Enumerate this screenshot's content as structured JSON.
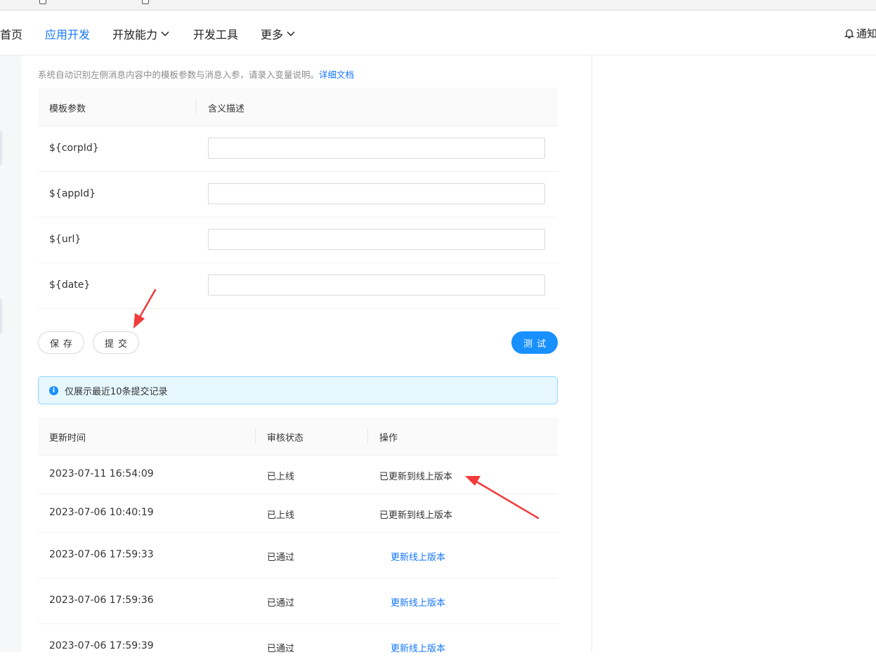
{
  "nav": {
    "items": [
      {
        "label": "首页",
        "active": false,
        "dropdown": false
      },
      {
        "label": "应用开发",
        "active": true,
        "dropdown": false
      },
      {
        "label": "开放能力",
        "active": false,
        "dropdown": true
      },
      {
        "label": "开发工具",
        "active": false,
        "dropdown": false
      },
      {
        "label": "更多",
        "active": false,
        "dropdown": true
      }
    ],
    "notify_label": "通知"
  },
  "section": {
    "description": "系统自动识别左侧消息内容中的模板参数与消息入参，请录入变量说明。",
    "doc_link": "详细文档"
  },
  "params_table": {
    "headers": [
      "模板参数",
      "含义描述"
    ],
    "rows": [
      {
        "name": "${corpId}",
        "value": ""
      },
      {
        "name": "${appId}",
        "value": ""
      },
      {
        "name": "${url}",
        "value": ""
      },
      {
        "name": "${date}",
        "value": ""
      }
    ]
  },
  "actions": {
    "save": "保存",
    "submit": "提交",
    "test": "测试"
  },
  "alert": {
    "text": "仅展示最近10条提交记录",
    "icon": "info-icon"
  },
  "records_table": {
    "headers": [
      "更新时间",
      "审核状态",
      "操作"
    ],
    "rows": [
      {
        "time": "2023-07-11 16:54:09",
        "status": "已上线",
        "action": "已更新到线上版本",
        "action_is_link": false
      },
      {
        "time": "2023-07-06 10:40:19",
        "status": "已上线",
        "action": "已更新到线上版本",
        "action_is_link": false
      },
      {
        "time": "2023-07-06 17:59:33",
        "status": "已通过",
        "action": "更新线上版本",
        "action_is_link": true
      },
      {
        "time": "2023-07-06 17:59:36",
        "status": "已通过",
        "action": "更新线上版本",
        "action_is_link": true
      },
      {
        "time": "2023-07-06 17:59:39",
        "status": "已通过",
        "action": "更新线上版本",
        "action_is_link": true
      }
    ]
  },
  "colors": {
    "accent": "#1677ff",
    "primary_button": "#1890ff",
    "alert_bg": "#e6f7ff",
    "alert_border": "#91d5ff",
    "annotation_arrow": "#f23b3b"
  }
}
